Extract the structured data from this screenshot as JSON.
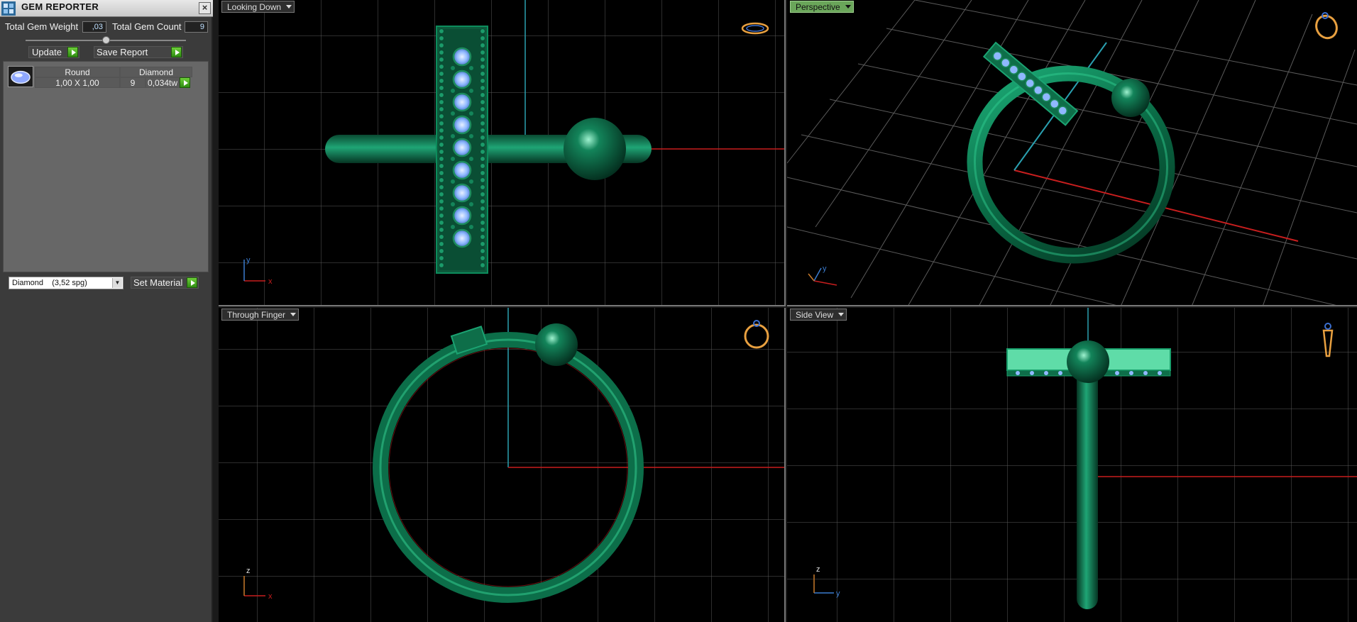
{
  "panel": {
    "title": "GEM REPORTER",
    "close_label": "×",
    "total_weight_label": "Total Gem Weight",
    "total_weight_value": ",03",
    "total_count_label": "Total Gem Count",
    "total_count_value": "9",
    "update_label": "Update",
    "save_report_label": "Save Report",
    "table": {
      "headers": [
        "Round",
        "Diamond"
      ],
      "row": {
        "size": "1,00 X 1,00",
        "count": "9",
        "weight": "0,034tw"
      }
    },
    "material_value": "Diamond    (3,52 spg)",
    "set_material_label": "Set Material"
  },
  "viewports": [
    {
      "label": "Looking Down",
      "active": false
    },
    {
      "label": "Perspective",
      "active": true
    },
    {
      "label": "Through Finger",
      "active": false
    },
    {
      "label": "Side View",
      "active": false
    }
  ],
  "axes": {
    "x": "x",
    "y": "y",
    "z": "z"
  },
  "colors": {
    "ring": "#0e7a52",
    "grid": "#5a5a5a",
    "x_axis": "#c81e1e",
    "y_axis": "#2aa0b0",
    "gem": "#8fb8ff",
    "accent": "#6aa65a"
  }
}
